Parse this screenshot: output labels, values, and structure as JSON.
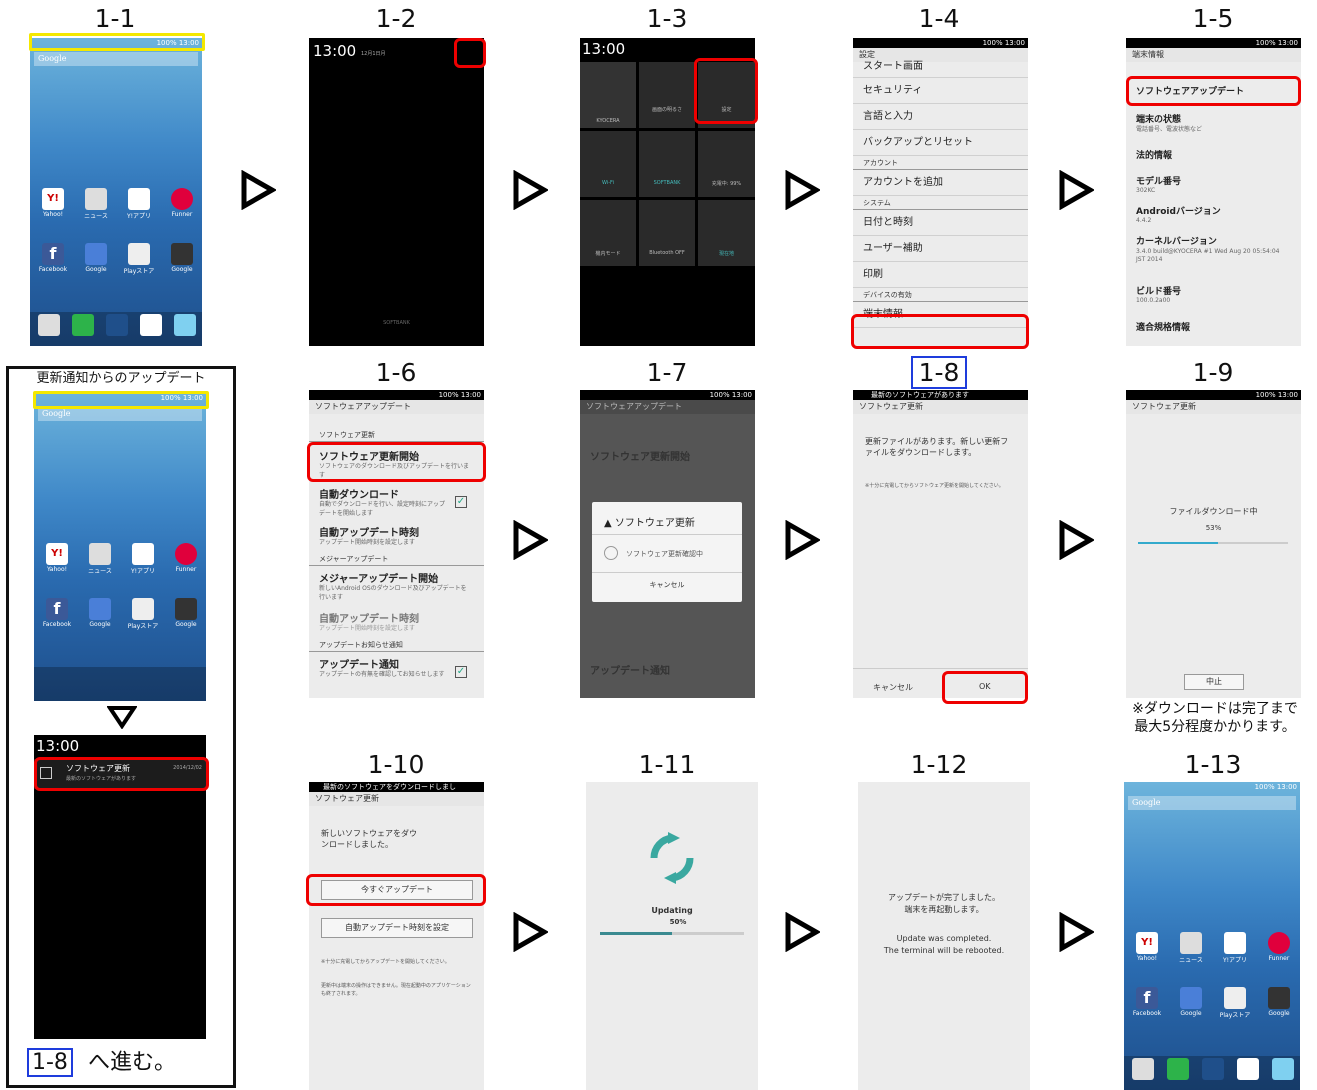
{
  "steps": {
    "s1_1": "1-1",
    "s1_2": "1-2",
    "s1_3": "1-3",
    "s1_4": "1-4",
    "s1_5": "1-5",
    "s1_6": "1-6",
    "s1_7": "1-7",
    "s1_8": "1-8",
    "s1_9": "1-9",
    "s1_10": "1-10",
    "s1_11": "1-11",
    "s1_12": "1-12",
    "s1_13": "1-13"
  },
  "status": {
    "bar": "100% 13:00",
    "time": "13:00",
    "date": "12月1日月"
  },
  "home": {
    "google": "Google",
    "apps1": [
      "Yahoo!",
      "ニュース",
      "Y!アプリ",
      "Funner"
    ],
    "apps2": [
      "Facebook",
      "Google",
      "Playストア",
      "Google"
    ],
    "dock": [
      "カメラ",
      "電話",
      "",
      "メール",
      "Y!ブラウザ"
    ]
  },
  "panel": {
    "title": "更新通知からのアップデート",
    "notif_title": "ソフトウェア更新",
    "notif_sub": "最新のソフトウェアがあります",
    "notif_date": "2014/12/02",
    "goto_step": "1-8",
    "goto_text": "へ進む。"
  },
  "s2": {
    "carrier": "SOFTBANK"
  },
  "s3": {
    "user": "KYOCERA",
    "tiles": [
      "画面の明るさ",
      "設定",
      "Wi-Fi",
      "SOFTBANK",
      "充電中: 99%",
      "機内モード",
      "Bluetooth OFF",
      "現在地"
    ]
  },
  "s4": {
    "title": "設定",
    "items": [
      "スタート画面",
      "セキュリティ",
      "言語と入力",
      "バックアップとリセット"
    ],
    "sec_account": "アカウント",
    "add_account": "アカウントを追加",
    "sec_system": "システム",
    "sys_items": [
      "日付と時刻",
      "ユーザー補助",
      "印刷"
    ],
    "dev": "デバイスの有効",
    "about": "端末情報"
  },
  "s5": {
    "title": "端末情報",
    "items": [
      {
        "t": "ソフトウェアアップデート",
        "s": ""
      },
      {
        "t": "端末の状態",
        "s": "電話番号、電波状態など"
      },
      {
        "t": "法的情報",
        "s": ""
      },
      {
        "t": "モデル番号",
        "s": "302KC"
      },
      {
        "t": "Androidバージョン",
        "s": "4.4.2"
      },
      {
        "t": "カーネルバージョン",
        "s": "3.4.0 build@KYOCERA #1 Wed Aug 20 05:54:04 JST 2014"
      },
      {
        "t": "ビルド番号",
        "s": "100.0.2a00"
      },
      {
        "t": "適合規格情報",
        "s": ""
      }
    ]
  },
  "s6": {
    "title": "ソフトウェアアップデート",
    "sec1": "ソフトウェア更新",
    "start": "ソフトウェア更新開始",
    "start_sub": "ソフトウェアのダウンロード及びアップデートを行います",
    "auto_dl": "自動ダウンロード",
    "auto_dl_sub": "自動でダウンロードを行い、設定時刻にアップデートを開始します",
    "auto_time": "自動アップデート時刻",
    "auto_time_sub": "アップデート開始時刻を設定します",
    "sec2": "メジャーアップデート",
    "major": "メジャーアップデート開始",
    "major_sub": "新しいAndroid OSのダウンロード及びアップデートを行います",
    "major_time": "自動アップデート時刻",
    "major_time_sub": "アップデート開始時刻を設定します",
    "sec3": "アップデートお知らせ通知",
    "notify": "アップデート通知",
    "notify_sub": "アップデートの有無を確認してお知らせします"
  },
  "s7": {
    "dialog_title": "ソフトウェア更新",
    "checking": "ソフトウェア更新確認中",
    "cancel": "キャンセル"
  },
  "s8": {
    "notif": "最新のソフトウェアがあります",
    "title": "ソフトウェア更新",
    "msg": "更新ファイルがあります。新しい更新ファイルをダウンロードします。",
    "note": "※十分に充電してからソフトウェア更新を開始してください。",
    "cancel": "キャンセル",
    "ok": "OK"
  },
  "s9": {
    "title": "ソフトウェア更新",
    "msg": "ファイルダウンロード中",
    "pct": "53%",
    "progress": 0.53,
    "stop": "中止",
    "note1": "※ダウンロードは完了まで",
    "note2": "最大5分程度かかります。"
  },
  "s10": {
    "notif": "最新のソフトウェアをダウンロードしまし",
    "title": "ソフトウェア更新",
    "msg": "新しいソフトウェアをダウンロードしました。",
    "now": "今すぐアップデート",
    "set_time": "自動アップデート時刻を設定",
    "note1": "※十分に充電してからアップデートを開始してください。",
    "note2": "更新中は端末の操作はできません。現在起動中のアプリケーションも終了されます。"
  },
  "s11": {
    "updating": "Updating",
    "pct": "50%",
    "progress": 0.5
  },
  "s12": {
    "jp1": "アップデートが完了しました。",
    "jp2": "端末を再起動します。",
    "en1": "Update was completed.",
    "en2": "The terminal will be rebooted."
  }
}
